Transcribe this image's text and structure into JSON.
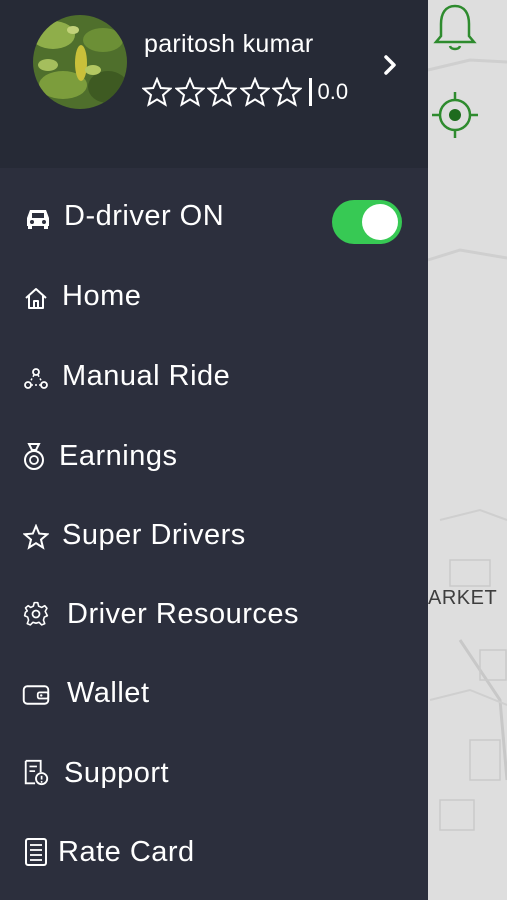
{
  "profile": {
    "name": "paritosh kumar",
    "rating": "0.0",
    "stars_filled": 0,
    "stars_total": 5
  },
  "status_toggle": {
    "label": "D-driver ON",
    "on": true,
    "color": "#37c954"
  },
  "menu": {
    "items": [
      {
        "label": "Home",
        "icon": "home-icon"
      },
      {
        "label": "Manual Ride",
        "icon": "manual-ride-icon"
      },
      {
        "label": "Earnings",
        "icon": "earnings-icon"
      },
      {
        "label": "Super Drivers",
        "icon": "star-icon"
      },
      {
        "label": "Driver Resources",
        "icon": "gear-icon"
      },
      {
        "label": "Wallet",
        "icon": "wallet-icon"
      },
      {
        "label": "Support",
        "icon": "support-icon"
      },
      {
        "label": "Rate Card",
        "icon": "rate-card-icon"
      }
    ]
  },
  "map": {
    "label": "ARKET",
    "accent": "#2e8b2e"
  },
  "colors": {
    "drawer_bg": "#2c2f3d",
    "header_bg": "#262a36",
    "toggle_on": "#37c954"
  }
}
